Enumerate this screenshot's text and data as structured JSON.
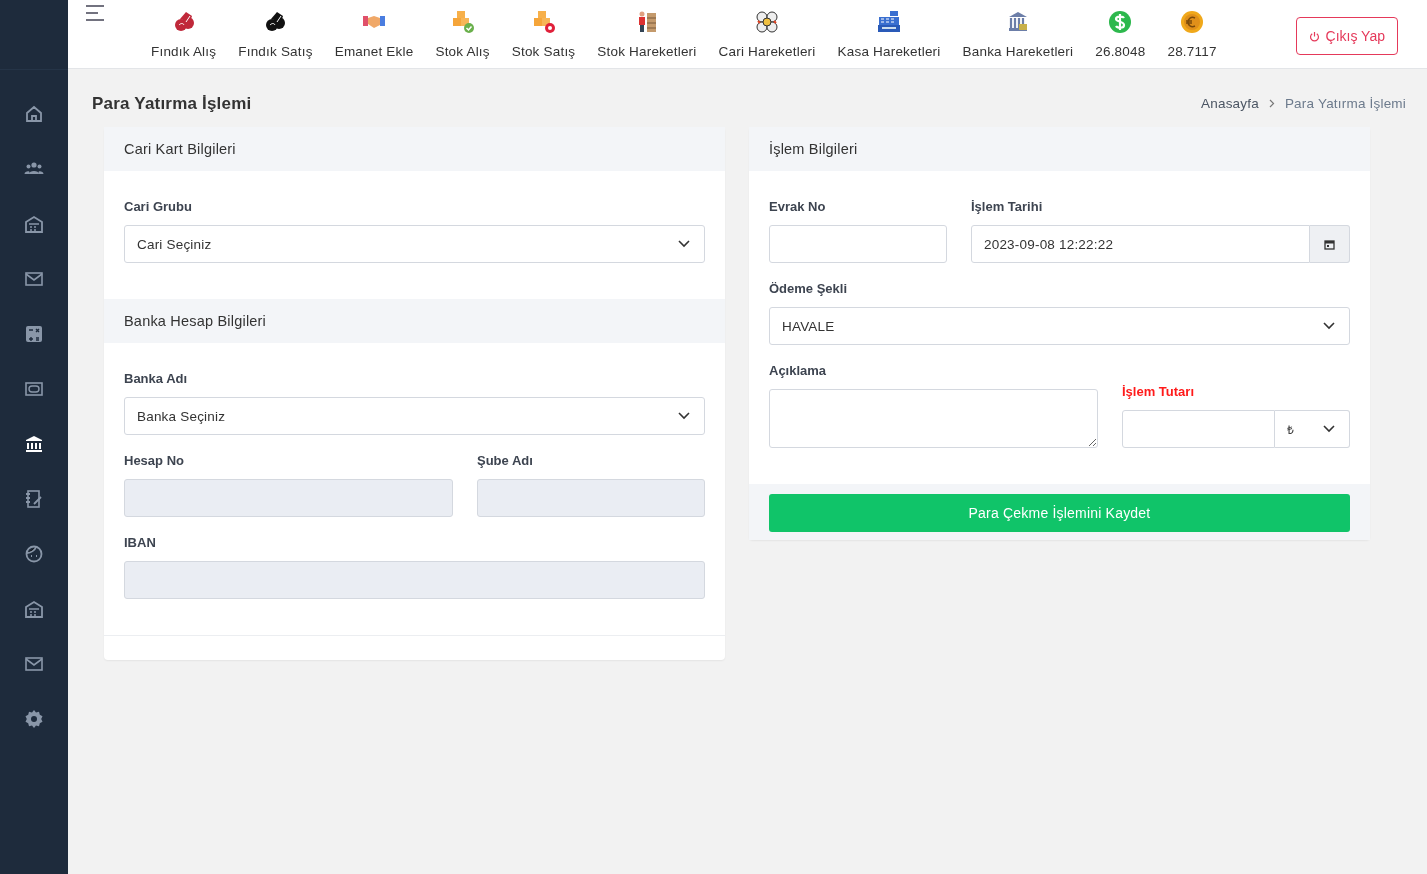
{
  "topbar": {
    "nav": [
      {
        "label": "Fındık Alış"
      },
      {
        "label": "Fındık Satış"
      },
      {
        "label": "Emanet Ekle"
      },
      {
        "label": "Stok Alış"
      },
      {
        "label": "Stok Satış"
      },
      {
        "label": "Stok Hareketleri"
      },
      {
        "label": "Cari Hareketleri"
      },
      {
        "label": "Kasa Hareketleri"
      },
      {
        "label": "Banka Hareketleri"
      },
      {
        "label": "26.8048"
      },
      {
        "label": "28.7117"
      }
    ],
    "logout": {
      "label": "Çıkış Yap"
    }
  },
  "sidebar": {
    "items": [
      {
        "selected": false
      },
      {
        "selected": false
      },
      {
        "selected": false
      },
      {
        "selected": false
      },
      {
        "selected": false
      },
      {
        "selected": false
      },
      {
        "selected": true
      },
      {
        "selected": false
      },
      {
        "selected": false
      },
      {
        "selected": false
      },
      {
        "selected": false
      },
      {
        "selected": false
      }
    ]
  },
  "page": {
    "title": "Para Yatırma İşlemi",
    "breadcrumb": [
      "Anasayfa",
      "Para Yatırma İşlemi"
    ]
  },
  "left_card": {
    "sections": [
      {
        "title": "Cari Kart Bilgileri",
        "rows": [
          [
            {
              "kind": "select",
              "label": "Cari Grubu",
              "value": "Cari Seçiniz",
              "required": false
            }
          ]
        ]
      },
      {
        "title": "Banka Hesap Bilgileri",
        "rows": [
          [
            {
              "kind": "select",
              "label": "Banka Adı",
              "value": "Banka Seçiniz",
              "required": false
            }
          ],
          [
            {
              "kind": "readonly",
              "label": "Hesap No",
              "required": false
            },
            {
              "kind": "readonly",
              "label": "Şube Adı",
              "required": false
            }
          ],
          [
            {
              "kind": "readonly",
              "label": "IBAN",
              "required": false
            }
          ]
        ]
      }
    ]
  },
  "right_card": {
    "sections": [
      {
        "title": "İşlem Bilgileri",
        "rows": [
          [
            {
              "kind": "text",
              "label": "Evrak No",
              "required": false
            },
            {
              "kind": "date",
              "label": "İşlem Tarihi",
              "value": "2023-09-08 12:22:22",
              "required": false
            }
          ],
          [
            {
              "kind": "select",
              "label": "Ödeme Şekli",
              "value": "HAVALE",
              "required": false
            }
          ],
          [
            {
              "kind": "textarea",
              "label": "Açıklama",
              "required": false
            },
            {
              "kind": "amount",
              "label": "İşlem Tutarı",
              "currency": "₺",
              "required": true
            }
          ]
        ]
      }
    ],
    "submit": {
      "label": "Para Çekme İşlemini Kaydet"
    }
  }
}
